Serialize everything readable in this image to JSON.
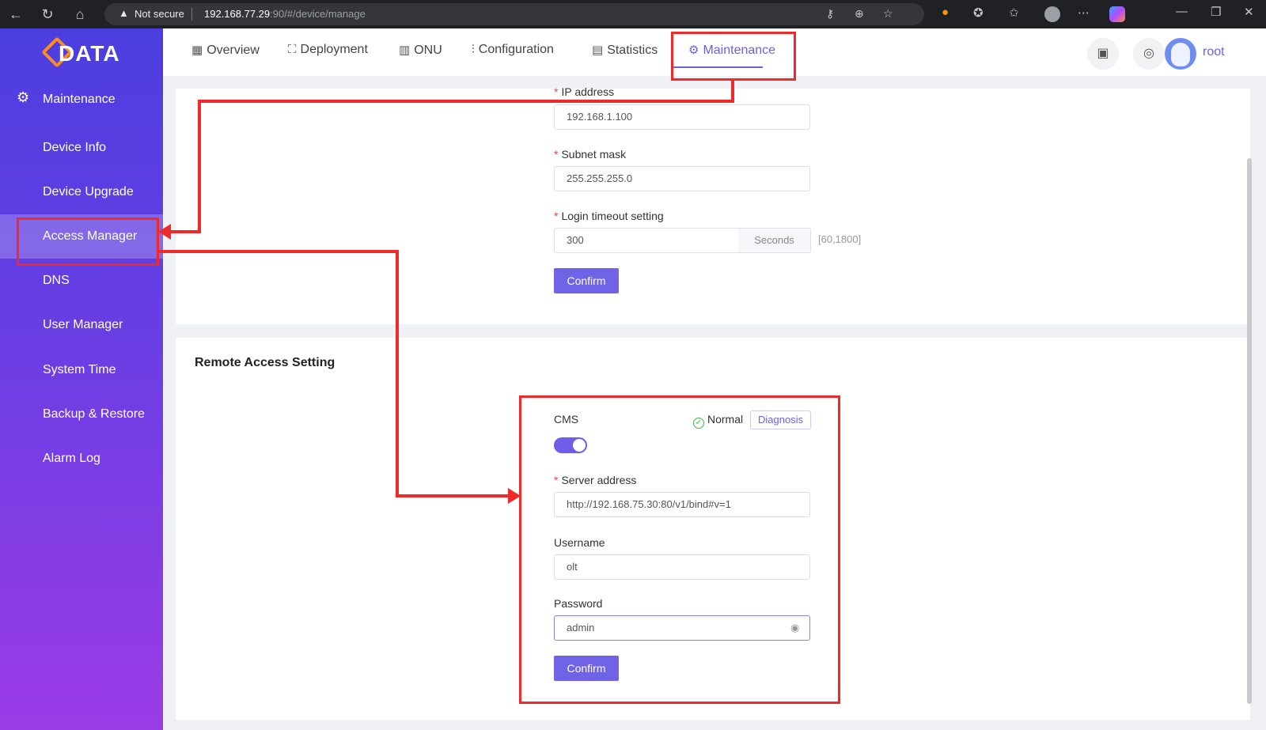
{
  "browser": {
    "security_label": "Not secure",
    "url_host": "192.168.77.29",
    "url_path": ":90/#/device/manage"
  },
  "logo_text": "DATA",
  "sidebar": {
    "header": "Maintenance",
    "items": [
      {
        "label": "Device Info"
      },
      {
        "label": "Device Upgrade"
      },
      {
        "label": "Access Manager",
        "active": true
      },
      {
        "label": "DNS"
      },
      {
        "label": "User Manager"
      },
      {
        "label": "System Time"
      },
      {
        "label": "Backup & Restore"
      },
      {
        "label": "Alarm Log"
      }
    ]
  },
  "topnav": {
    "tabs": [
      {
        "label": "Overview",
        "icon": "grid-icon"
      },
      {
        "label": "Deployment",
        "icon": "deployment-icon"
      },
      {
        "label": "ONU",
        "icon": "onu-icon"
      },
      {
        "label": "Configuration",
        "icon": "sliders-icon"
      },
      {
        "label": "Statistics",
        "icon": "statistics-icon"
      },
      {
        "label": "Maintenance",
        "icon": "gear-icon",
        "active": true
      }
    ],
    "user": "root"
  },
  "local_access": {
    "ip_label": "IP address",
    "ip_value": "192.168.1.100",
    "mask_label": "Subnet mask",
    "mask_value": "255.255.255.0",
    "timeout_label": "Login timeout setting",
    "timeout_value": "300",
    "timeout_unit": "Seconds",
    "timeout_range": "[60,1800]",
    "confirm_label": "Confirm"
  },
  "remote_access": {
    "title": "Remote Access Setting",
    "cms_label": "CMS",
    "cms_enabled": true,
    "status_text": "Normal",
    "diagnosis_label": "Diagnosis",
    "server_label": "Server address",
    "server_value": "http://192.168.75.30:80/v1/bind#v=1",
    "username_label": "Username",
    "username_value": "olt",
    "password_label": "Password",
    "password_value": "admin",
    "confirm_label": "Confirm"
  },
  "colors": {
    "accent": "#6f5ee8",
    "annotation": "#ee2a2a",
    "sidebar_top": "#4c3ee0",
    "sidebar_bottom": "#9b3be6"
  }
}
